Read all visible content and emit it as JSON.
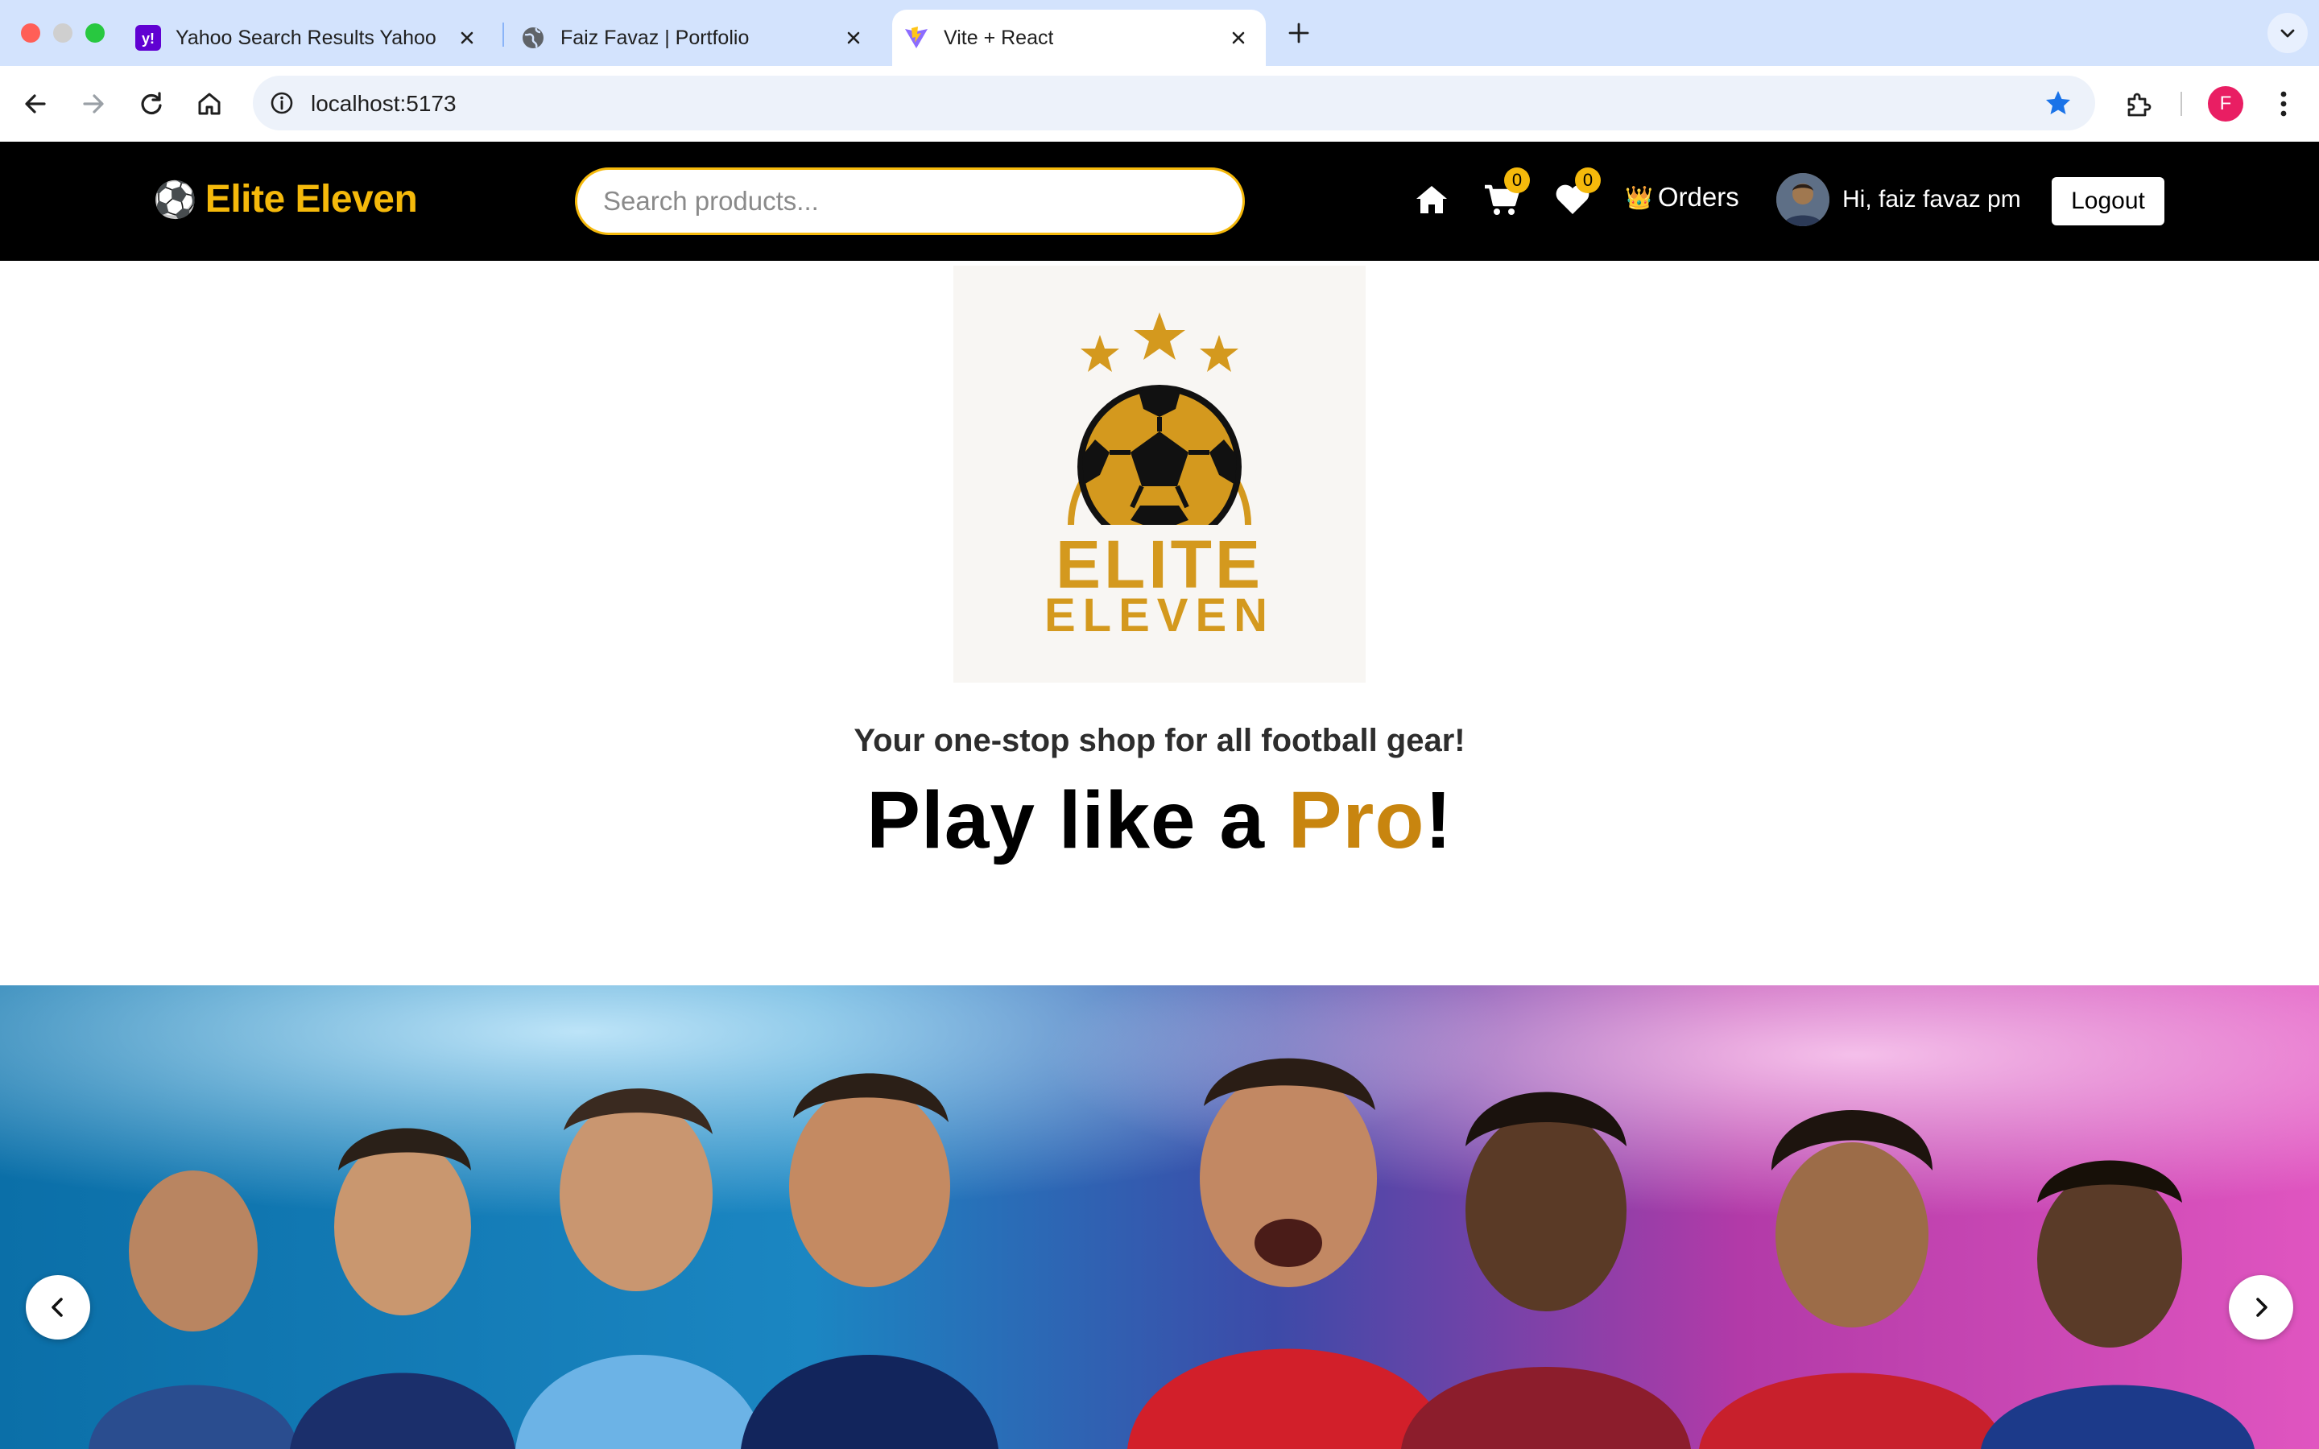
{
  "browser": {
    "tabs": [
      {
        "title": "Yahoo Search Results Yahoo I",
        "favicon": "yahoo-icon",
        "active": false
      },
      {
        "title": "Faiz Favaz | Portfolio",
        "favicon": "globe-icon",
        "active": false
      },
      {
        "title": "Vite + React",
        "favicon": "vite-icon",
        "active": true
      }
    ],
    "url": "localhost:5173",
    "profile_initial": "F",
    "colors": {
      "tabstrip": "#d3e3fd",
      "profile": "#e91e63",
      "bookmark_star": "#1a73e8"
    }
  },
  "navbar": {
    "brand_emoji": "⚽",
    "brand": "Elite Eleven",
    "search_placeholder": "Search products...",
    "cart_count": "0",
    "wishlist_count": "0",
    "orders_emoji": "👑",
    "orders_label": "Orders",
    "greeting": "Hi, faiz favaz pm",
    "logout_label": "Logout",
    "colors": {
      "background": "#000000",
      "accent": "#f5b90b"
    }
  },
  "hero": {
    "logo_line1": "ELITE",
    "logo_line2": "ELEVEN",
    "tagline": "Your one-stop shop for all football gear!",
    "headline_pre": "Play like a ",
    "headline_highlight": "Pro",
    "headline_post": "!",
    "colors": {
      "gold": "#c8850f",
      "logo_gold": "#d4991e"
    }
  },
  "carousel": {
    "prev_icon": "chevron-left-icon",
    "next_icon": "chevron-right-icon"
  }
}
